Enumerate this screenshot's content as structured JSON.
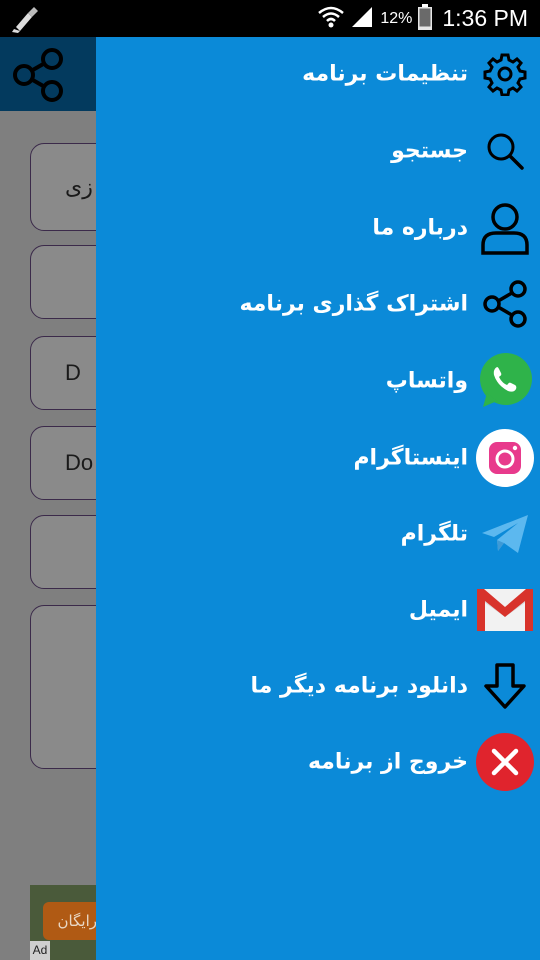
{
  "status_bar": {
    "battery": "12%",
    "time": "1:36 PM",
    "icons": [
      "cleaner-icon",
      "wifi-icon",
      "signal-icon",
      "battery-icon"
    ]
  },
  "background": {
    "header_icon": "share-icon",
    "cards": [
      {
        "text": "زی"
      },
      {
        "text": ""
      },
      {
        "text": "D"
      },
      {
        "text": "Do"
      },
      {
        "text": ""
      },
      {
        "text": ""
      }
    ],
    "ad": {
      "button_text": "رایگان",
      "label": "Ad"
    }
  },
  "drawer": {
    "background_color": "#0b8ad8",
    "items": [
      {
        "label": "تنظیمات برنامه",
        "icon": "settings-gear-icon"
      },
      {
        "label": "جستجو",
        "icon": "search-icon"
      },
      {
        "label": "درباره ما",
        "icon": "user-icon"
      },
      {
        "label": "اشتراک گذاری برنامه",
        "icon": "share-icon"
      },
      {
        "label": "واتساپ",
        "icon": "whatsapp-icon"
      },
      {
        "label": "اینستاگرام",
        "icon": "instagram-icon"
      },
      {
        "label": "تلگرام",
        "icon": "telegram-icon"
      },
      {
        "label": "ایمیل",
        "icon": "gmail-icon"
      },
      {
        "label": "دانلود برنامه دیگر ما",
        "icon": "download-arrow-icon"
      },
      {
        "label": "خروج از برنامه",
        "icon": "close-exit-icon"
      }
    ]
  }
}
